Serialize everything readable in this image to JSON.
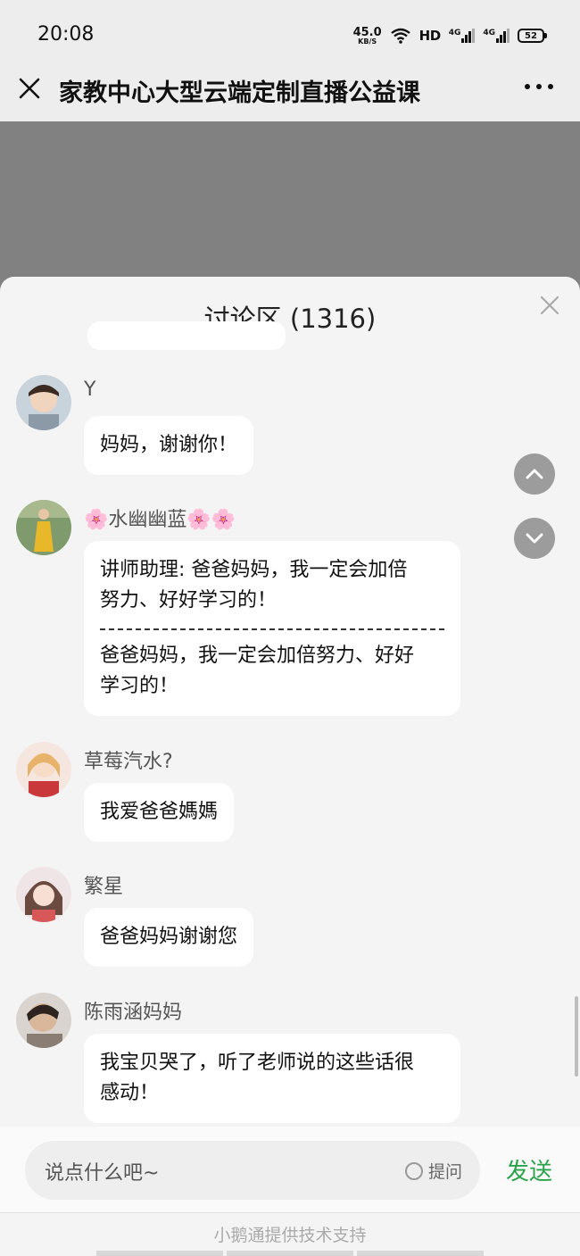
{
  "status_bar": {
    "time": "20:08",
    "net_speed_value": "45.0",
    "net_speed_unit": "KB/S",
    "hd_label": "HD",
    "signal1_label": "4G",
    "signal2_label": "4G",
    "battery": "52"
  },
  "title_bar": {
    "title": "家教中心大型云端定制直播公益课"
  },
  "panel": {
    "title": "讨论区 (1316)"
  },
  "messages": [
    {
      "username": "Y",
      "lines": [
        "妈妈，谢谢你！"
      ],
      "quote": null
    },
    {
      "username": "🌸水幽幽蓝🌸🌸",
      "lines": [
        "讲师助理: 爸爸妈妈，我一定会加倍",
        "努力、好好学习的！"
      ],
      "quote": [
        "爸爸妈妈，我一定会加倍努力、好好",
        "学习的！"
      ]
    },
    {
      "username": "草莓汽水?",
      "lines": [
        "我爱爸爸媽媽"
      ],
      "quote": null
    },
    {
      "username": "繁星",
      "lines": [
        "爸爸妈妈谢谢您"
      ],
      "quote": null
    },
    {
      "username": "陈雨涵妈妈",
      "lines": [
        "我宝贝哭了，听了老师说的这些话很",
        "感动！"
      ],
      "quote": null
    }
  ],
  "input": {
    "placeholder": "说点什么吧~",
    "ask_label": "提问",
    "send_label": "发送"
  },
  "footer": {
    "text": "小鹅通提供技术支持"
  },
  "colors": {
    "accent": "#2aa34a",
    "panel_bg": "#f4f4f4",
    "video_bg": "#818181"
  }
}
